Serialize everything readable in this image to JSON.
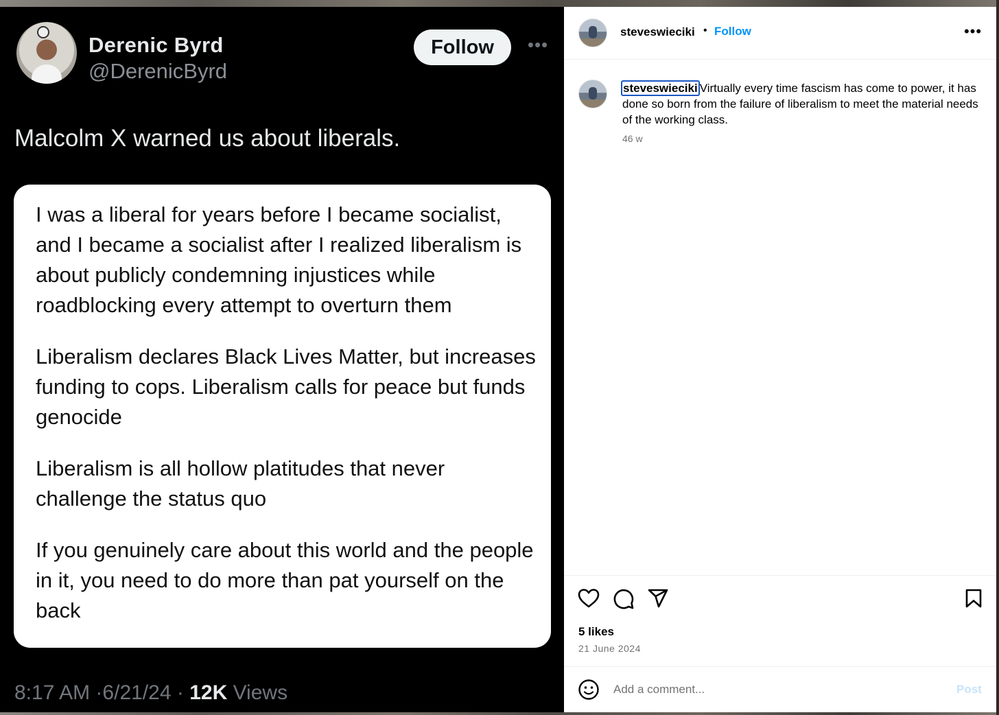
{
  "tweet": {
    "name": "Derenic Byrd",
    "handle": "@DerenicByrd",
    "follow_label": "Follow",
    "more_label": "•••",
    "text": "Malcolm X warned us about liberals.",
    "quote_paragraphs": [
      "I was a liberal for years before I became socialist, and I became a socialist after I realized liberalism is about publicly condemning injustices while roadblocking every attempt to overturn them",
      "Liberalism declares Black Lives Matter, but increases funding to cops. Liberalism calls for peace but funds genocide",
      "Liberalism is all hollow platitudes that never challenge the status quo",
      "If you genuinely care about this world and the people in it, you need to do more than pat yourself on the back"
    ],
    "time": "8:17 AM",
    "date": "6/21/24",
    "separator": "·",
    "views_count": "12K",
    "views_label": "Views"
  },
  "post": {
    "username": "steveswieciki",
    "dot": "•",
    "follow_label": "Follow",
    "more_label": "•••",
    "caption_username": "steveswieciki",
    "caption_text": "Virtually every time fascism has come to power, it has done so born from the failure of liberalism to meet the material needs of the working class.",
    "time_ago": "46 w",
    "likes": "5 likes",
    "date": "21 June 2024",
    "comment_placeholder": "Add a comment...",
    "post_label": "Post"
  },
  "icons": [
    "heart-icon",
    "comment-icon",
    "share-icon",
    "bookmark-icon",
    "emoji-icon"
  ],
  "colors": {
    "ig_link_blue": "#0095f6",
    "ig_post_disabled": "#c7e3fb",
    "tweet_bg": "#000000",
    "tweet_follow_bg": "#eff3f4"
  }
}
